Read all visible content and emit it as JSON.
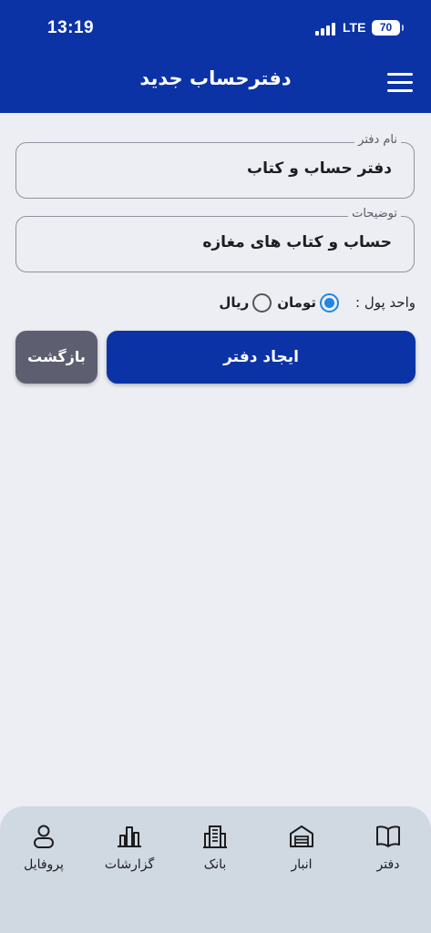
{
  "status_bar": {
    "time": "13:19",
    "network": "LTE",
    "battery": "70"
  },
  "header": {
    "title": "دفترحساب جدید",
    "menu_icon": "hamburger-menu-icon"
  },
  "form": {
    "name_label": "نام دفتر",
    "name_value": "دفتر حساب و کتاب",
    "description_label": "توضیحات",
    "description_value": "حساب و کتاب های مغازه",
    "currency_label": "واحد پول :",
    "currency_options": [
      {
        "label": "تومان",
        "selected": true
      },
      {
        "label": "ریال",
        "selected": false
      }
    ]
  },
  "actions": {
    "create_label": "ایجاد دفتر",
    "back_label": "بازگشت"
  },
  "bottom_nav": [
    {
      "label": "دفتر",
      "icon": "open-book-icon"
    },
    {
      "label": "انبار",
      "icon": "warehouse-icon"
    },
    {
      "label": "بانک",
      "icon": "bank-building-icon"
    },
    {
      "label": "گزارشات",
      "icon": "bar-chart-icon"
    },
    {
      "label": "پروفایل",
      "icon": "user-profile-icon"
    }
  ],
  "colors": {
    "primary": "#0b33a6",
    "secondary": "#5d5f70",
    "radio_selected": "#1f86e6",
    "background": "#eceef3",
    "nav_background": "#d0d8e2"
  }
}
